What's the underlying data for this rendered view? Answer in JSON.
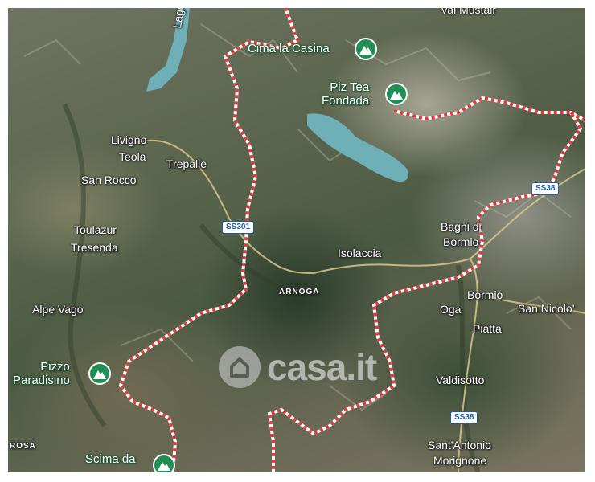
{
  "map": {
    "places": [
      {
        "id": "livigno",
        "text": "Livigno"
      },
      {
        "id": "teola",
        "text": "Teola"
      },
      {
        "id": "trepalle",
        "text": "Trepalle"
      },
      {
        "id": "san-rocco",
        "text": "San Rocco"
      },
      {
        "id": "toulazur",
        "text": "Toulazur"
      },
      {
        "id": "tresenda",
        "text": "Tresenda"
      },
      {
        "id": "alpe-vago",
        "text": "Alpe Vago"
      },
      {
        "id": "isolaccia",
        "text": "Isolaccia"
      },
      {
        "id": "bagni-di",
        "text": "Bagni di"
      },
      {
        "id": "bormio-bagni",
        "text": "Bormio"
      },
      {
        "id": "oga",
        "text": "Oga"
      },
      {
        "id": "bormio",
        "text": "Bormio"
      },
      {
        "id": "san-nicolo",
        "text": "San Nicolo'"
      },
      {
        "id": "piatta",
        "text": "Piatta"
      },
      {
        "id": "valdisotto",
        "text": "Valdisotto"
      },
      {
        "id": "santantonio",
        "text": "Sant'Antonio"
      },
      {
        "id": "morignone",
        "text": "Morignone"
      },
      {
        "id": "lago",
        "text": "Lago d"
      },
      {
        "id": "val-mustair",
        "text": "Val Mustair"
      }
    ],
    "small_caps_labels": [
      {
        "id": "arnoga",
        "text": "ARNOGA"
      },
      {
        "id": "rosa",
        "text": "ROSA"
      }
    ],
    "peaks": [
      {
        "id": "cima-la-casina",
        "lines": [
          "Cima la Casina"
        ],
        "icon": "mountain-icon"
      },
      {
        "id": "piz-tea-fondada",
        "lines": [
          "Piz Tea",
          "Fondada"
        ],
        "icon": "mountain-icon"
      },
      {
        "id": "pizzo-paradisino",
        "lines": [
          "Pizzo",
          "Paradisino"
        ],
        "icon": "mountain-icon"
      },
      {
        "id": "scima-da",
        "lines": [
          "Scima da"
        ],
        "icon": "mountain-icon"
      }
    ],
    "road_shields": [
      {
        "id": "ss301",
        "text": "SS301"
      },
      {
        "id": "ss38-north",
        "text": "SS38"
      },
      {
        "id": "ss38-south",
        "text": "SS38"
      }
    ],
    "watermark": {
      "text": "casa.it",
      "icon": "house-icon"
    },
    "colors": {
      "boundary": "#e23b3b",
      "peak_pin": "#1f8f55",
      "lake": "#6fb0b8",
      "road": "#d9c98a",
      "road_shield": "#1a5aa8"
    }
  }
}
